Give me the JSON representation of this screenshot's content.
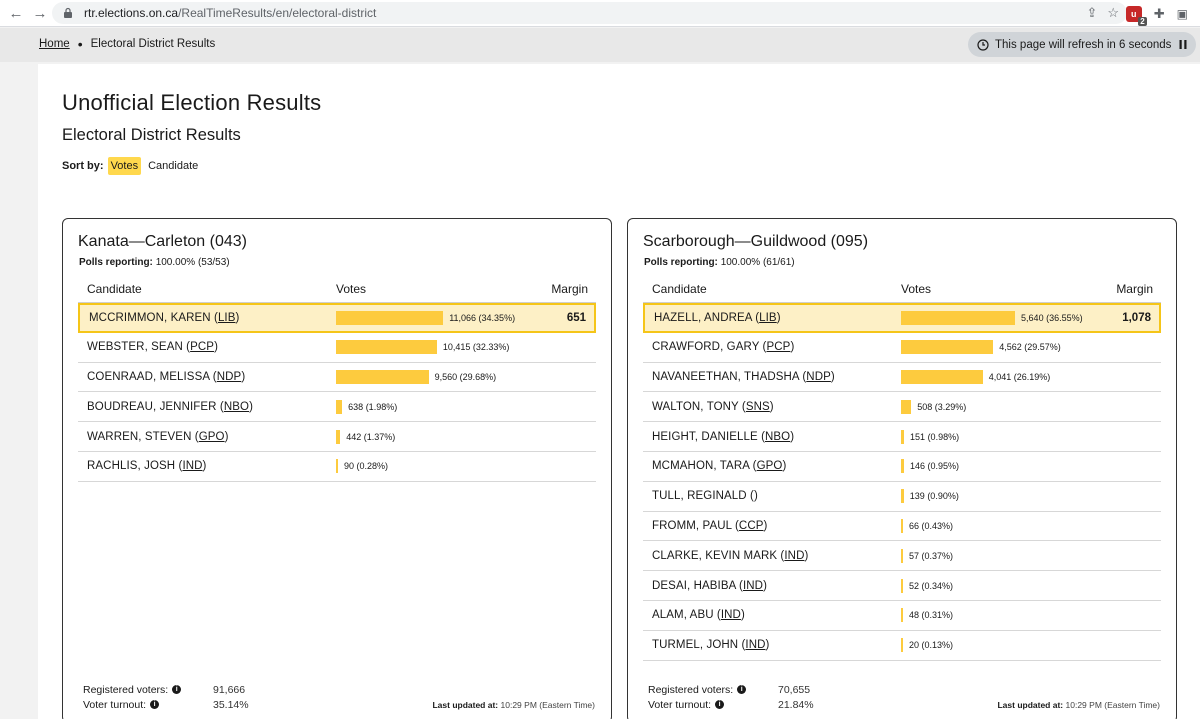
{
  "browser": {
    "url_host": "rtr.elections.on.ca",
    "url_path": "/RealTimeResults/en/electoral-district",
    "extension_badge_count": "2"
  },
  "breadcrumb": {
    "home": "Home",
    "current": "Electoral District Results"
  },
  "refresh": {
    "text": "This page will refresh in 6 seconds"
  },
  "page": {
    "title": "Unofficial Election Results",
    "subtitle": "Electoral District Results",
    "sort_label": "Sort by:",
    "sort_options": [
      "Votes",
      "Candidate"
    ]
  },
  "table_headers": {
    "candidate": "Candidate",
    "votes": "Votes",
    "margin": "Margin"
  },
  "labels": {
    "polls_reporting": "Polls reporting:",
    "registered_voters": "Registered voters:",
    "voter_turnout": "Voter turnout:",
    "last_updated": "Last updated at:"
  },
  "colors": {
    "bar": "#fdcb3e",
    "winner_bg": "#fdf0c6",
    "winner_border": "#f5c518",
    "sort_active": "#ffd84d"
  },
  "districts": [
    {
      "name": "Kanata—Carleton (043)",
      "polls": "100.00% (53/53)",
      "registered_voters": "91,666",
      "voter_turnout": "35.14%",
      "last_updated": "10:29 PM (Eastern Time)",
      "candidates": [
        {
          "name": "MCCRIMMON, KAREN (",
          "party": "LIB",
          "close": ")",
          "votes": "11,066 (34.35%)",
          "pct": 34.35,
          "margin": "651"
        },
        {
          "name": "WEBSTER, SEAN (",
          "party": "PCP",
          "close": ")",
          "votes": "10,415 (32.33%)",
          "pct": 32.33,
          "margin": ""
        },
        {
          "name": "COENRAAD, MELISSA (",
          "party": "NDP",
          "close": ")",
          "votes": "9,560 (29.68%)",
          "pct": 29.68,
          "margin": ""
        },
        {
          "name": "BOUDREAU, JENNIFER (",
          "party": "NBO",
          "close": ")",
          "votes": "638 (1.98%)",
          "pct": 1.98,
          "margin": ""
        },
        {
          "name": "WARREN, STEVEN (",
          "party": "GPO",
          "close": ")",
          "votes": "442 (1.37%)",
          "pct": 1.37,
          "margin": ""
        },
        {
          "name": "RACHLIS, JOSH (",
          "party": "IND",
          "close": ")",
          "votes": "90 (0.28%)",
          "pct": 0.28,
          "margin": ""
        }
      ]
    },
    {
      "name": "Scarborough—Guildwood (095)",
      "polls": "100.00% (61/61)",
      "registered_voters": "70,655",
      "voter_turnout": "21.84%",
      "last_updated": "10:29 PM (Eastern Time)",
      "candidates": [
        {
          "name": "HAZELL, ANDREA (",
          "party": "LIB",
          "close": ")",
          "votes": "5,640 (36.55%)",
          "pct": 36.55,
          "margin": "1,078"
        },
        {
          "name": "CRAWFORD, GARY (",
          "party": "PCP",
          "close": ")",
          "votes": "4,562 (29.57%)",
          "pct": 29.57,
          "margin": ""
        },
        {
          "name": "NAVANEETHAN, THADSHA (",
          "party": "NDP",
          "close": ")",
          "votes": "4,041 (26.19%)",
          "pct": 26.19,
          "margin": ""
        },
        {
          "name": "WALTON, TONY (",
          "party": "SNS",
          "close": ")",
          "votes": "508 (3.29%)",
          "pct": 3.29,
          "margin": ""
        },
        {
          "name": "HEIGHT, DANIELLE (",
          "party": "NBO",
          "close": ")",
          "votes": "151 (0.98%)",
          "pct": 0.98,
          "margin": ""
        },
        {
          "name": "MCMAHON, TARA (",
          "party": "GPO",
          "close": ")",
          "votes": "146 (0.95%)",
          "pct": 0.95,
          "margin": ""
        },
        {
          "name": "TULL, REGINALD (",
          "party": "",
          "close": ")",
          "votes": "139 (0.90%)",
          "pct": 0.9,
          "margin": ""
        },
        {
          "name": "FROMM, PAUL (",
          "party": "CCP",
          "close": ")",
          "votes": "66 (0.43%)",
          "pct": 0.43,
          "margin": ""
        },
        {
          "name": "CLARKE, KEVIN MARK (",
          "party": "IND",
          "close": ")",
          "votes": "57 (0.37%)",
          "pct": 0.37,
          "margin": ""
        },
        {
          "name": "DESAI, HABIBA (",
          "party": "IND",
          "close": ")",
          "votes": "52 (0.34%)",
          "pct": 0.34,
          "margin": ""
        },
        {
          "name": "ALAM, ABU (",
          "party": "IND",
          "close": ")",
          "votes": "48 (0.31%)",
          "pct": 0.31,
          "margin": ""
        },
        {
          "name": "TURMEL, JOHN (",
          "party": "IND",
          "close": ")",
          "votes": "20 (0.13%)",
          "pct": 0.13,
          "margin": ""
        }
      ]
    }
  ]
}
